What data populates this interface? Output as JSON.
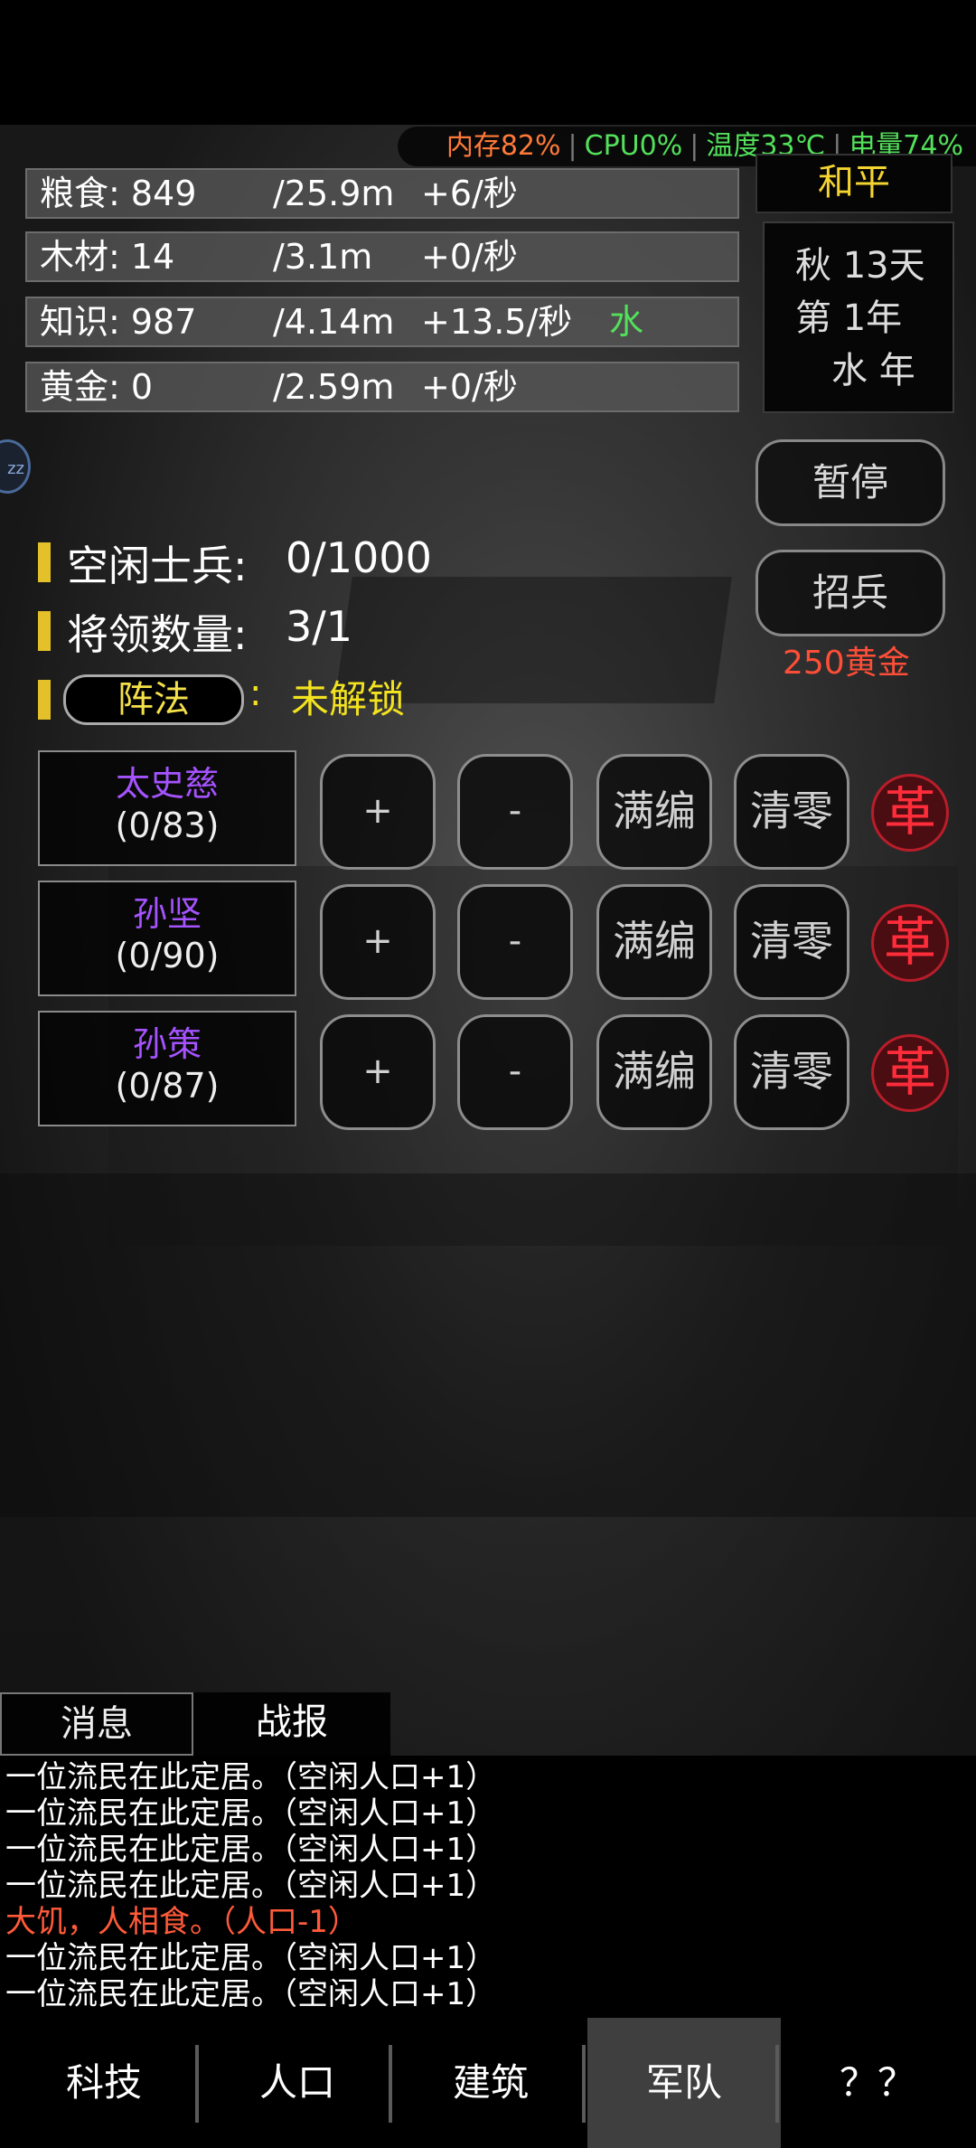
{
  "status": {
    "memory": "内存82%",
    "cpu": "CPU0%",
    "temperature": "温度33℃",
    "battery": "电量74%",
    "colors": {
      "memory": "#ff7a3a",
      "cpu": "#53e05a",
      "temperature": "#53e05a",
      "battery": "#53e05a"
    }
  },
  "resources": [
    {
      "label": "粮食: 849",
      "cap": "/25.9m",
      "rate": "+6/秒",
      "tag": ""
    },
    {
      "label": "木材: 14",
      "cap": "/3.1m",
      "rate": "+0/秒",
      "tag": ""
    },
    {
      "label": "知识: 987",
      "cap": "/4.14m",
      "rate": "+13.5/秒",
      "tag": "水"
    },
    {
      "label": "黄金: 0",
      "cap": "/2.59m",
      "rate": "+0/秒",
      "tag": ""
    }
  ],
  "state": "和平",
  "calendar": {
    "line1": "秋 13天",
    "line2": "第 1年",
    "line3": "水 年"
  },
  "sleep_icon_label": "zz",
  "buttons": {
    "pause": "暂停",
    "recruit": "招兵",
    "recruit_cost": "250黄金"
  },
  "army": {
    "idle_soldiers_label": "空闲士兵:",
    "idle_soldiers_value": "0/1000",
    "generals_label": "将领数量:",
    "generals_value": "3/1",
    "formation_button": "阵法",
    "formation_colon": ":",
    "formation_status": "未解锁"
  },
  "generals": [
    {
      "name": "太史慈",
      "count": "(0/83)"
    },
    {
      "name": "孙坚",
      "count": "(0/90)"
    },
    {
      "name": "孙策",
      "count": "(0/87)"
    }
  ],
  "general_actions": {
    "add": "+",
    "remove": "-",
    "fill": "满编",
    "clear": "清零",
    "revolt": "革"
  },
  "log_tabs": {
    "messages": "消息",
    "battle": "战报"
  },
  "log": [
    {
      "text": "一位流民在此定居。（空闲人口+1）",
      "color": "#ffffff"
    },
    {
      "text": "一位流民在此定居。（空闲人口+1）",
      "color": "#ffffff"
    },
    {
      "text": "一位流民在此定居。（空闲人口+1）",
      "color": "#ffffff"
    },
    {
      "text": "一位流民在此定居。（空闲人口+1）",
      "color": "#ffffff"
    },
    {
      "text": "大饥，人相食。（人口-1）",
      "color": "#ff5a3a"
    },
    {
      "text": "一位流民在此定居。（空闲人口+1）",
      "color": "#ffffff"
    },
    {
      "text": "一位流民在此定居。（空闲人口+1）",
      "color": "#ffffff"
    }
  ],
  "nav": {
    "tech": "科技",
    "population": "人口",
    "building": "建筑",
    "army": "军队",
    "unknown": "？？",
    "active": "army"
  }
}
